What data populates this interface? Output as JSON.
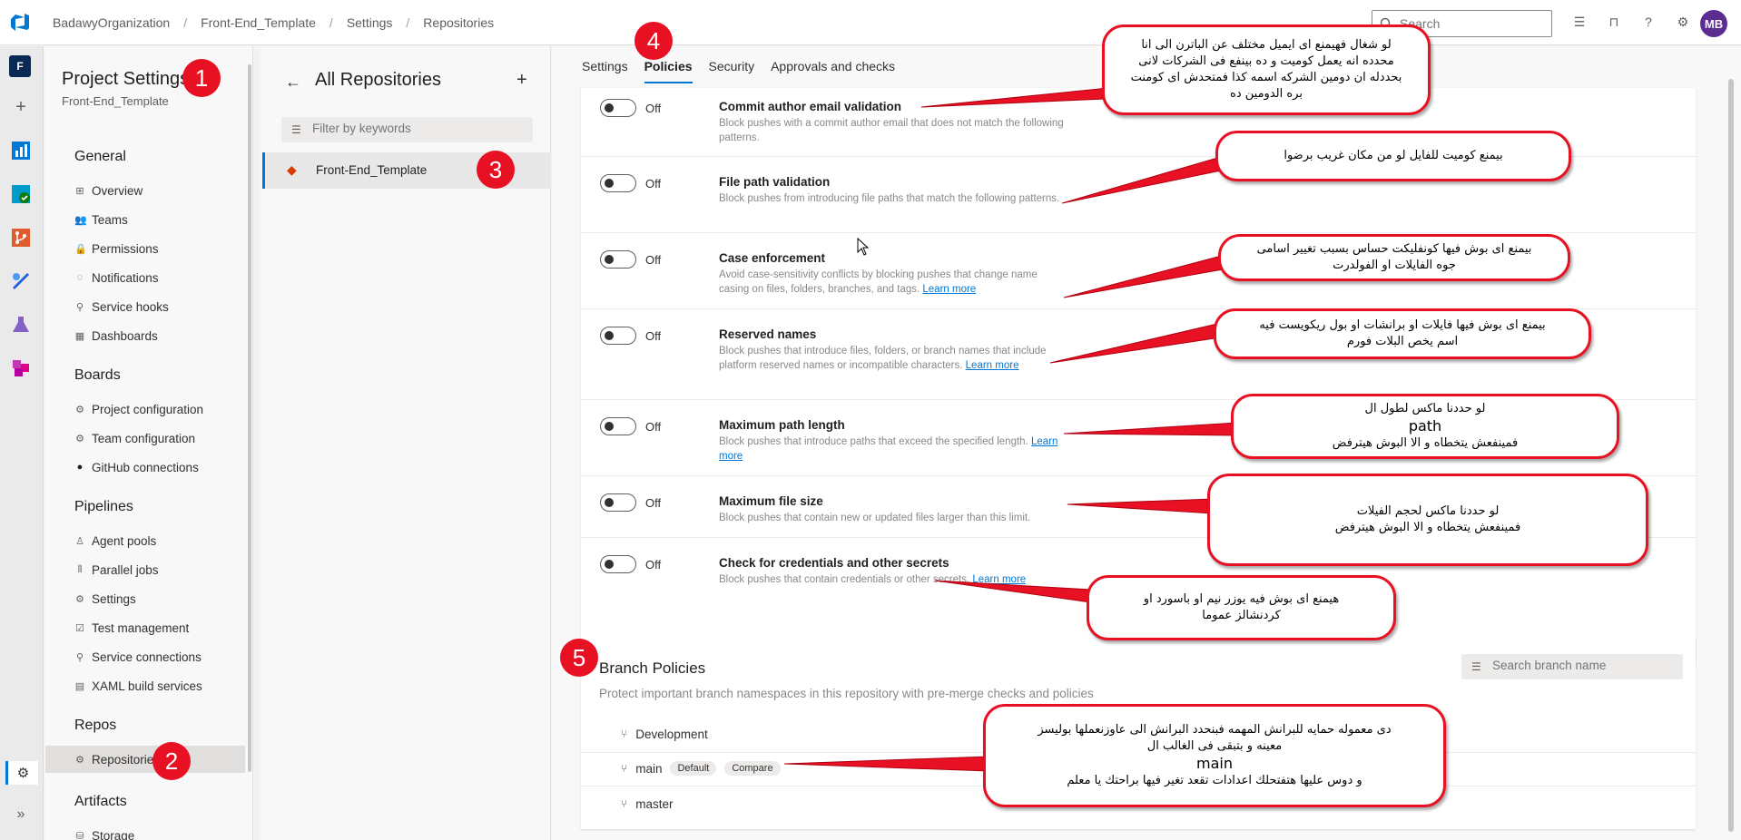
{
  "topbar": {
    "breadcrumbs": [
      "BadawyOrganization",
      "Front-End_Template",
      "Settings",
      "Repositories"
    ],
    "search_placeholder": "Search",
    "avatar_initials": "MB",
    "icons": [
      "list-check-icon",
      "shopping-bag-icon",
      "help-icon",
      "user-settings-icon"
    ]
  },
  "rail": {
    "project_initial": "F",
    "icons": [
      "plus-icon",
      "overview-icon",
      "boards-icon",
      "repos-icon",
      "pipelines-icon",
      "test-plans-icon",
      "artifacts-icon",
      "settings-gear-icon",
      "expand-icon"
    ]
  },
  "settings_nav": {
    "title": "Project Settings",
    "subtitle": "Front-End_Template",
    "sections": [
      {
        "label": "General",
        "items": [
          "Overview",
          "Teams",
          "Permissions",
          "Notifications",
          "Service hooks",
          "Dashboards"
        ]
      },
      {
        "label": "Boards",
        "items": [
          "Project configuration",
          "Team configuration",
          "GitHub connections"
        ]
      },
      {
        "label": "Pipelines",
        "items": [
          "Agent pools",
          "Parallel jobs",
          "Settings",
          "Test management",
          "Service connections",
          "XAML build services"
        ]
      },
      {
        "label": "Repos",
        "items": [
          "Repositories"
        ]
      },
      {
        "label": "Artifacts",
        "items": [
          "Storage"
        ]
      }
    ]
  },
  "repo_panel": {
    "title": "All Repositories",
    "filter_placeholder": "Filter by keywords",
    "repos": [
      "Front-End_Template"
    ]
  },
  "tabs": [
    "Settings",
    "Policies",
    "Security",
    "Approvals and checks"
  ],
  "active_tab": "Policies",
  "policies": [
    {
      "title": "Commit author email validation",
      "state": "Off",
      "desc": "Block pushes with a commit author email that does not match the following patterns.",
      "link": ""
    },
    {
      "title": "File path validation",
      "state": "Off",
      "desc": "Block pushes from introducing file paths that match the following patterns.",
      "link": ""
    },
    {
      "title": "Case enforcement",
      "state": "Off",
      "desc": "Avoid case-sensitivity conflicts by blocking pushes that change name casing on files, folders, branches, and tags.",
      "link": "Learn more"
    },
    {
      "title": "Reserved names",
      "state": "Off",
      "desc": "Block pushes that introduce files, folders, or branch names that include platform reserved names or incompatible characters.",
      "link": "Learn more"
    },
    {
      "title": "Maximum path length",
      "state": "Off",
      "desc": "Block pushes that introduce paths that exceed the specified length.",
      "link": "Learn more"
    },
    {
      "title": "Maximum file size",
      "state": "Off",
      "desc": "Block pushes that contain new or updated files larger than this limit.",
      "link": ""
    },
    {
      "title": "Check for credentials and other secrets",
      "state": "Off",
      "desc": "Block pushes that contain credentials or other secrets.",
      "link": "Learn more"
    }
  ],
  "branch_policies": {
    "title": "Branch Policies",
    "subtitle": "Protect important branch namespaces in this repository with pre-merge checks and policies",
    "search_placeholder": "Search branch name",
    "branches": [
      {
        "name": "Development",
        "badges": []
      },
      {
        "name": "main",
        "badges": [
          "Default",
          "Compare"
        ]
      },
      {
        "name": "master",
        "badges": []
      }
    ]
  },
  "annotations": {
    "numbers": [
      "1",
      "2",
      "3",
      "4",
      "5"
    ],
    "callouts": [
      [
        "لو شغال فهيمنع اى ايميل مختلف  عن الباترن الى انا",
        "محدده انه يعمل كوميت و ده بينفع فى الشركات لانى",
        "بحددله ان دومين الشركه اسمه كذا فمتحدش اى كومنت",
        "بره الدومين ده"
      ],
      [
        "بيمنع كوميت للفايل لو من مكان غريب برضوا"
      ],
      [
        "بيمنع اى بوش فيها كونفليكت حساس بسبب تغيير اسامى",
        "جوه الفايلات او الفولدرت"
      ],
      [
        "بيمنع اى بوش فيها فايلات او برانشات او بول ريكويست فيه",
        "اسم يخص البلات فورم"
      ],
      [
        "لو حددنا ماكس لطول ال",
        "path",
        "فمينفعش يتخطاه و الا البوش هيترفض"
      ],
      [
        "لو حددنا ماكس لحجم الفيلات",
        "فمينفعش يتخطاه و الا البوش هيترفض"
      ],
      [
        "هيمنع اى بوش فيه  يوزر نيم او باسورد او",
        "كردنشالز عموما"
      ],
      [
        "دى معموله حمايه للبرانش المهمه فبنحدد البرانش الى عاوزنعملها بوليسز",
        "معينه و بتبقى فى الغالب ال",
        "main",
        "و دوس عليها هتفتحلك اعدادات تقعد تغير فيها براحتك يا معلم"
      ]
    ]
  },
  "colors": {
    "accent": "#0078d4",
    "annotation_red": "#e81123",
    "avatar": "#5c2d91"
  }
}
